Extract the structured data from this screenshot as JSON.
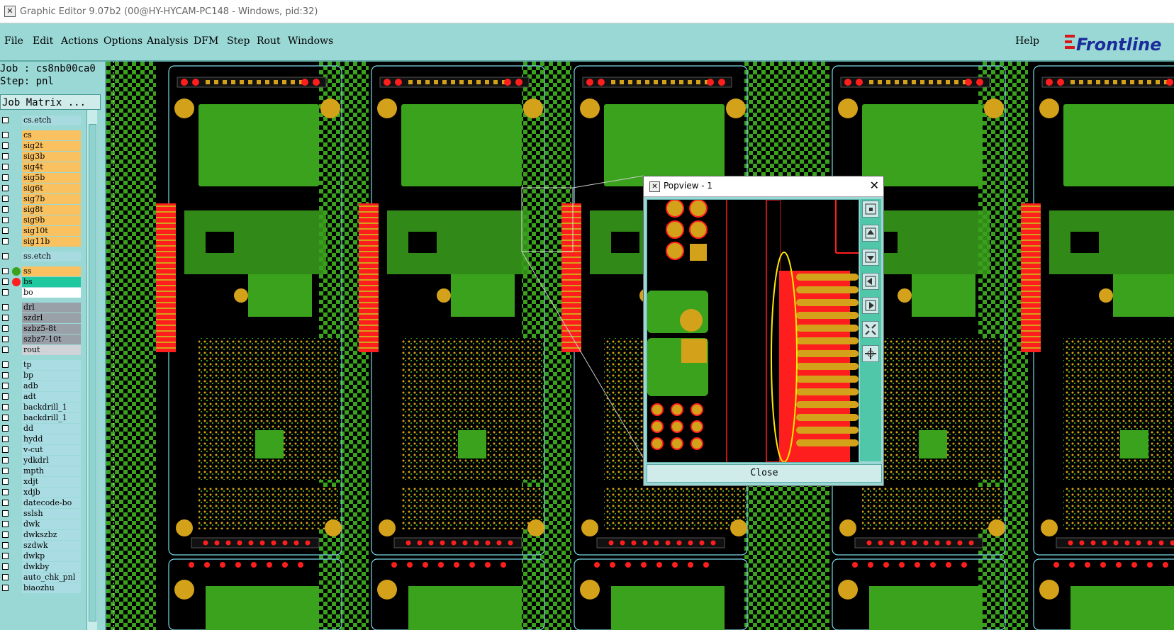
{
  "window": {
    "title": "Graphic Editor 9.07b2 (00@HY-HYCAM-PC148 - Windows, pid:32)"
  },
  "menu": {
    "items": [
      "File",
      "Edit",
      "Actions",
      "Options",
      "Analysis",
      "DFM",
      "Step",
      "Rout",
      "Windows"
    ],
    "help": "Help",
    "brand": "Frontline"
  },
  "job": {
    "job_line": "Job : cs8nb00ca0",
    "step_line": "Step: pnl",
    "matrix_button": "Job Matrix ..."
  },
  "layers": [
    {
      "name": "cs.etch",
      "kind": "board"
    },
    {
      "name": "cs",
      "kind": "signal"
    },
    {
      "name": "sig2t",
      "kind": "signal"
    },
    {
      "name": "sig3b",
      "kind": "signal"
    },
    {
      "name": "sig4t",
      "kind": "signal"
    },
    {
      "name": "sig5b",
      "kind": "signal"
    },
    {
      "name": "sig6t",
      "kind": "signal"
    },
    {
      "name": "sig7b",
      "kind": "signal"
    },
    {
      "name": "sig8t",
      "kind": "signal"
    },
    {
      "name": "sig9b",
      "kind": "signal"
    },
    {
      "name": "sig10t",
      "kind": "signal"
    },
    {
      "name": "sig11b",
      "kind": "signal"
    },
    {
      "name": "ss.etch",
      "kind": "board"
    },
    {
      "name": "ss",
      "kind": "signal"
    },
    {
      "name": "bs",
      "kind": "sel"
    },
    {
      "name": "bo",
      "kind": "white"
    },
    {
      "name": "drl",
      "kind": "drill"
    },
    {
      "name": "szdrl",
      "kind": "drill"
    },
    {
      "name": "szbz5-8t",
      "kind": "drill"
    },
    {
      "name": "szbz7-10t",
      "kind": "drill"
    },
    {
      "name": "rout",
      "kind": "rout"
    },
    {
      "name": "tp",
      "kind": "misc"
    },
    {
      "name": "bp",
      "kind": "misc"
    },
    {
      "name": "adb",
      "kind": "misc"
    },
    {
      "name": "adt",
      "kind": "misc"
    },
    {
      "name": "backdrill_1",
      "kind": "misc"
    },
    {
      "name": "backdrill_1",
      "kind": "misc"
    },
    {
      "name": "dd",
      "kind": "misc"
    },
    {
      "name": "hydd",
      "kind": "misc"
    },
    {
      "name": "v-cut",
      "kind": "misc"
    },
    {
      "name": "ydkdrl",
      "kind": "misc"
    },
    {
      "name": "mpth",
      "kind": "misc"
    },
    {
      "name": "xdjt",
      "kind": "misc"
    },
    {
      "name": "xdjb",
      "kind": "misc"
    },
    {
      "name": "datecode-bo",
      "kind": "misc"
    },
    {
      "name": "sslsh",
      "kind": "misc"
    },
    {
      "name": "dwk",
      "kind": "misc"
    },
    {
      "name": "dwkszbz",
      "kind": "misc"
    },
    {
      "name": "szdwk",
      "kind": "misc"
    },
    {
      "name": "dwkp",
      "kind": "misc"
    },
    {
      "name": "dwkby",
      "kind": "misc"
    },
    {
      "name": "auto_chk_pnl",
      "kind": "misc"
    },
    {
      "name": "biaozhu",
      "kind": "misc"
    }
  ],
  "popview": {
    "title": "Popview - 1",
    "close_label": "Close"
  },
  "colors": {
    "teal": "#9ad8d6",
    "green": "#3aa21c",
    "gold": "#d4a21a",
    "red": "#ff1e1e",
    "cyan": "#78d8e8"
  }
}
